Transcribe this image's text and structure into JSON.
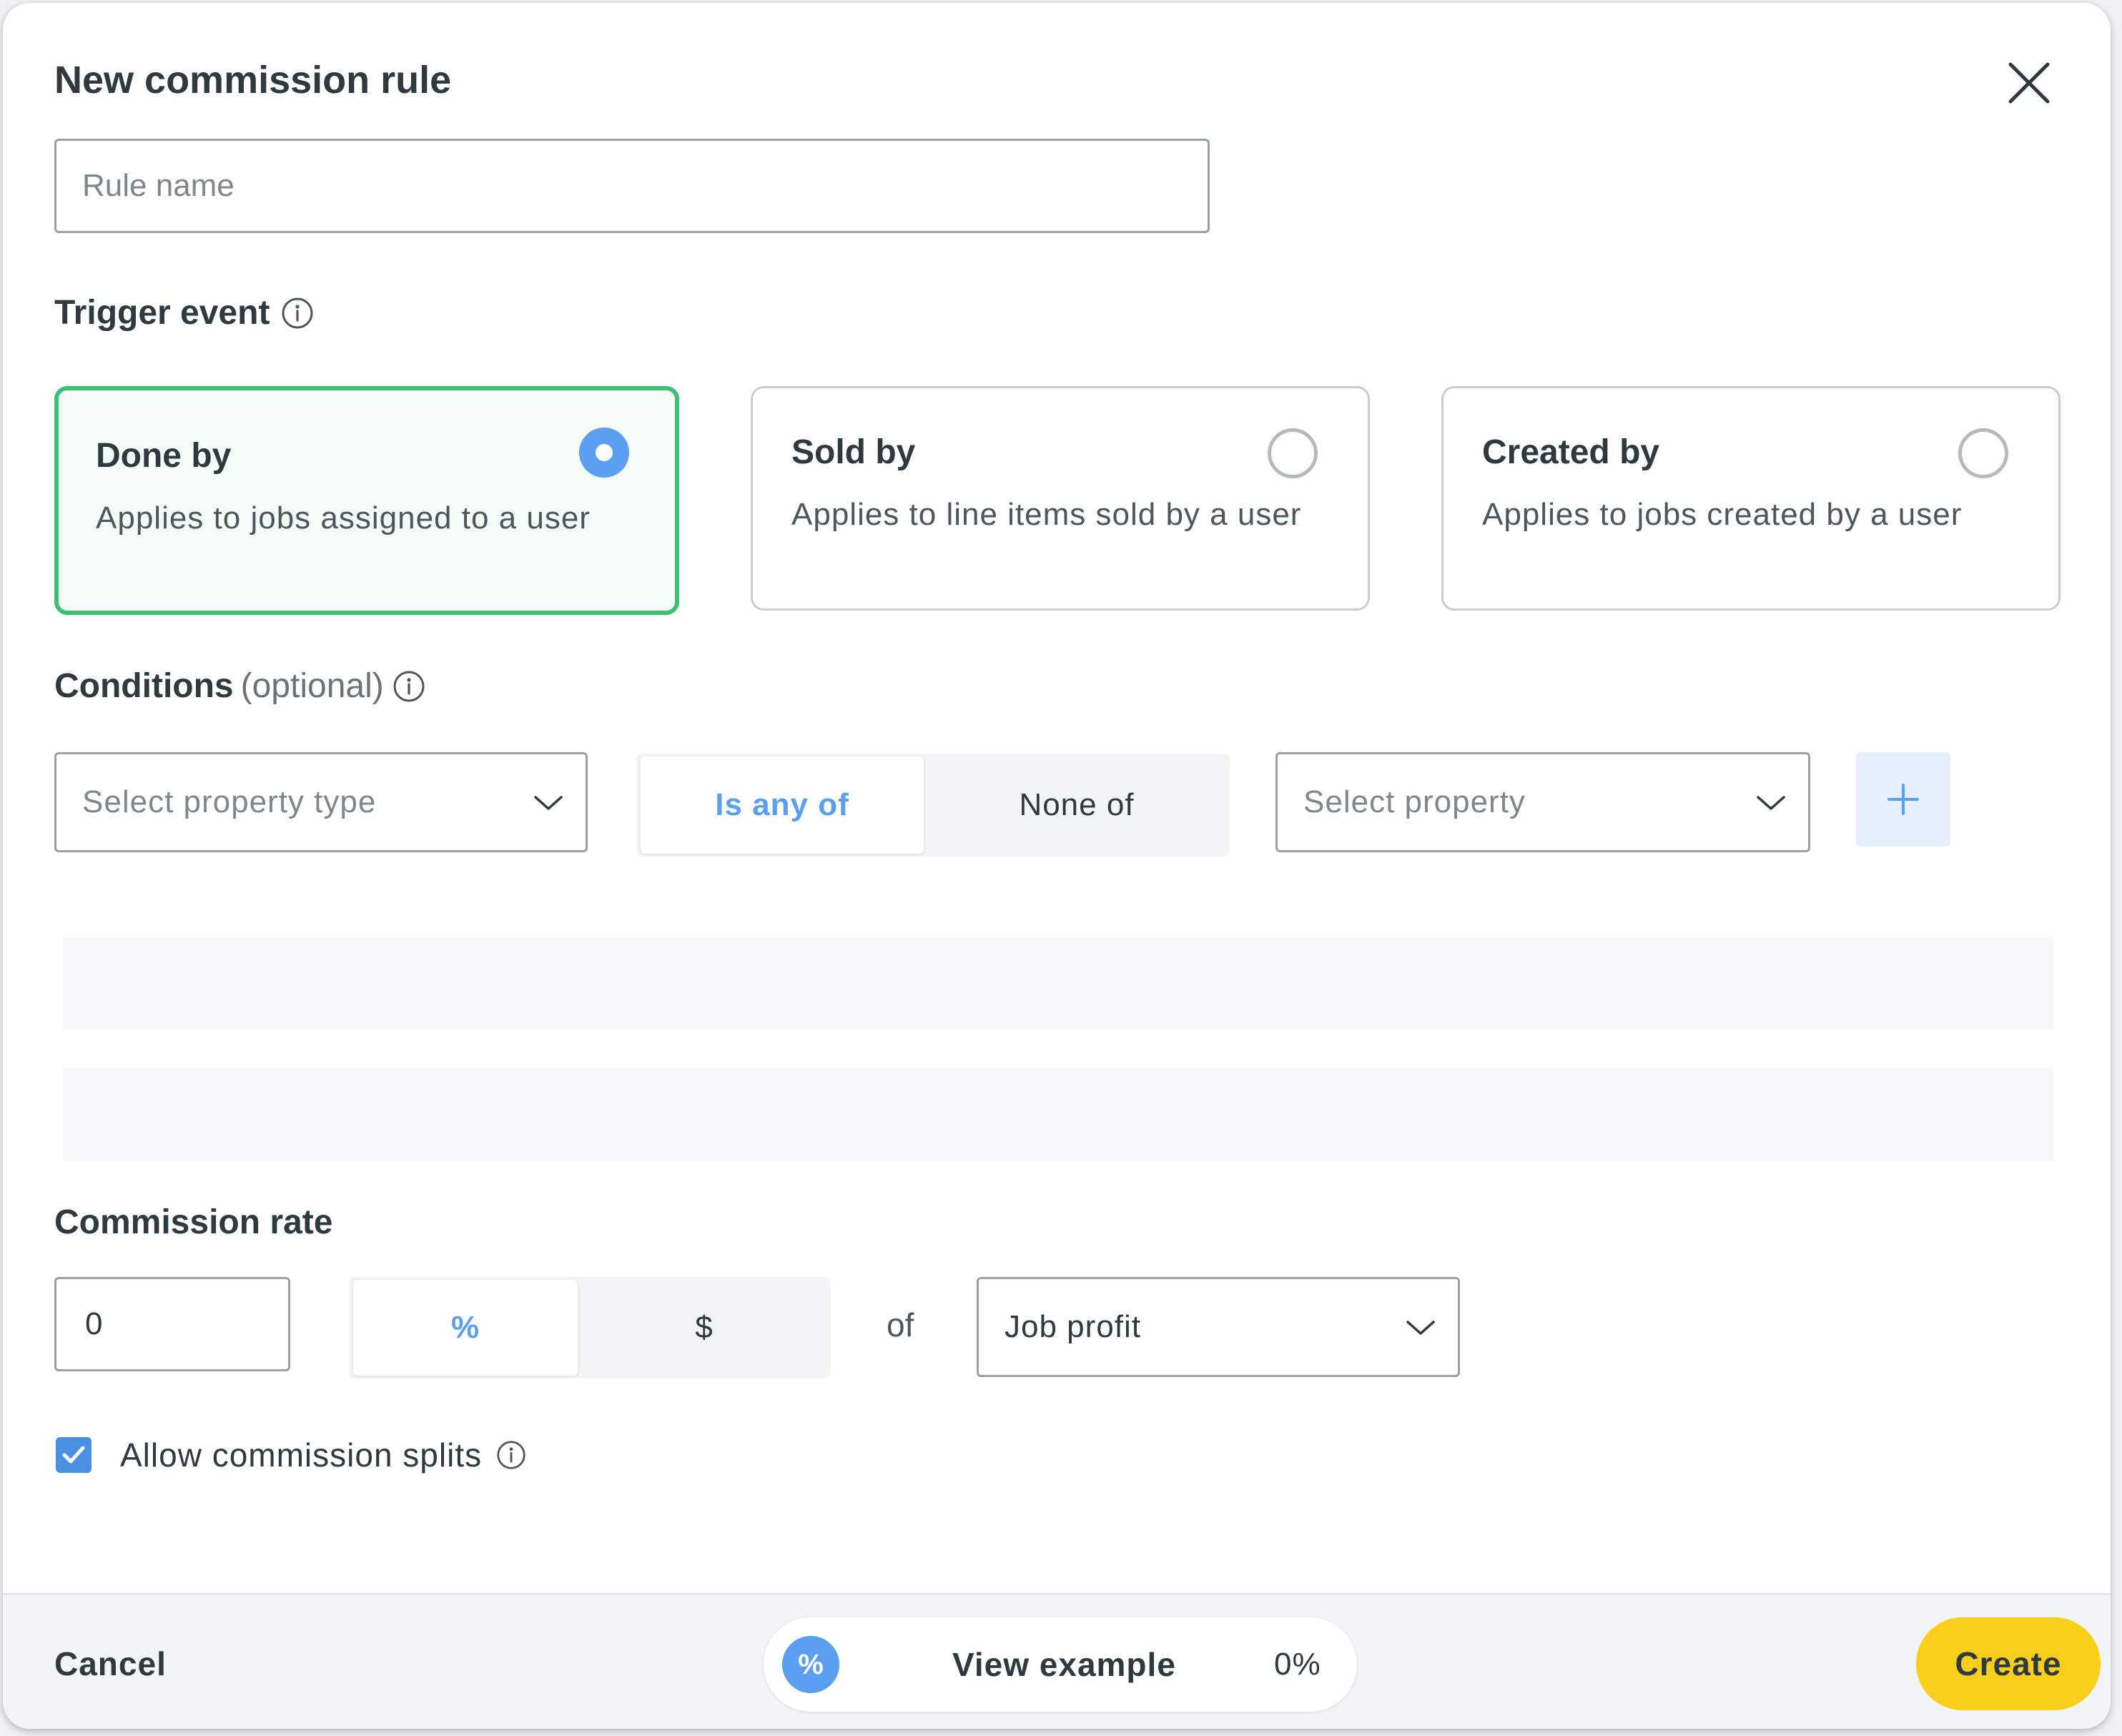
{
  "modal": {
    "title": "New commission rule",
    "close_icon": "close-icon"
  },
  "rule_name": {
    "value": "",
    "placeholder": "Rule name"
  },
  "trigger": {
    "label": "Trigger event",
    "info_icon": "info-icon",
    "options": [
      {
        "title": "Done by",
        "description": "Applies to jobs assigned to a user",
        "selected": true
      },
      {
        "title": "Sold by",
        "description": "Applies to line items sold by a user",
        "selected": false
      },
      {
        "title": "Created by",
        "description": "Applies to jobs created by a user",
        "selected": false
      }
    ]
  },
  "conditions": {
    "label": "Conditions",
    "optional_label": "(optional)",
    "property_type_placeholder": "Select property type",
    "operator_options": [
      "Is any of",
      "None of"
    ],
    "operator_selected": "Is any of",
    "property_placeholder": "Select property",
    "add_icon": "plus-icon"
  },
  "commission": {
    "label": "Commission rate",
    "rate_value": "0",
    "unit_options": [
      "%",
      "$"
    ],
    "unit_selected": "%",
    "of_label": "of",
    "basis_value": "Job profit"
  },
  "splits": {
    "label": "Allow commission splits",
    "checked": true
  },
  "footer": {
    "cancel_label": "Cancel",
    "example_icon_text": "%",
    "example_label": "View example",
    "example_value": "0%",
    "create_label": "Create"
  },
  "colors": {
    "accent_blue": "#5b9ff0",
    "selected_green": "#3dbf77",
    "create_yellow": "#f9cf1c",
    "text_dark": "#2f3a40"
  }
}
